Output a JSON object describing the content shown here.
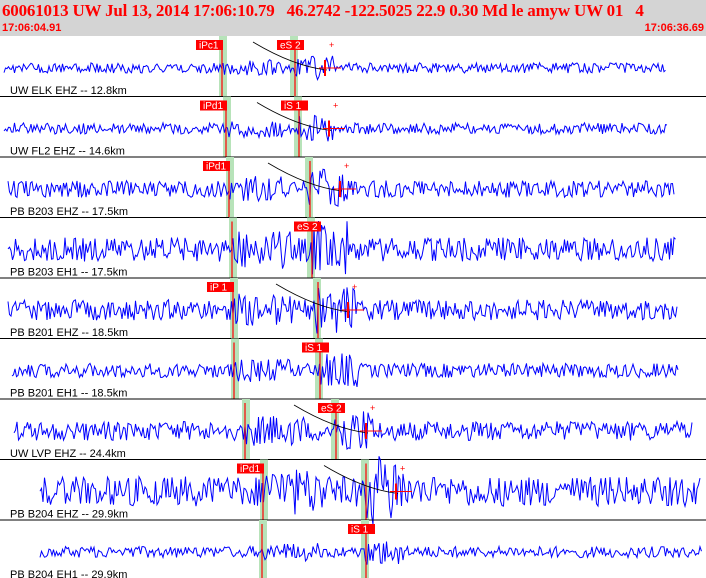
{
  "header": {
    "title": "60061013 UW Jul 13, 2014 17:06:10.79   46.2742 -122.5025 22.9 0.30 Md le amyw UW 01   4",
    "start_time": "17:06:04.91",
    "end_time": "17:06:36.69",
    "background_color": "#d4d4d4",
    "text_color": "#ff0000"
  },
  "colors": {
    "trace": "#0000ff",
    "pick": "#ff0000",
    "pick_band": "#b7e3b9",
    "divider": "#000000"
  },
  "traces": [
    {
      "label": "UW ELK EHZ -- 12.8km",
      "amp": 0.18,
      "p_pick": "iPc1",
      "s_pick": "eS 2",
      "coda": true
    },
    {
      "label": "UW FL2 EHZ -- 14.6km",
      "amp": 0.22,
      "p_pick": "iPd1",
      "s_pick": "iS 1",
      "coda": true
    },
    {
      "label": "PB B203 EHZ -- 17.5km",
      "amp": 0.45,
      "p_pick": "iPd1",
      "s_pick": "",
      "coda": true
    },
    {
      "label": "PB B203 EH1 -- 17.5km",
      "amp": 0.75,
      "p_pick": "",
      "s_pick": "eS 2",
      "coda": false
    },
    {
      "label": "PB B201 EHZ -- 18.5km",
      "amp": 0.6,
      "p_pick": "iP 1",
      "s_pick": "",
      "coda": true
    },
    {
      "label": "PB B201 EH1 -- 18.5km",
      "amp": 0.35,
      "p_pick": "",
      "s_pick": "iS 1",
      "coda": false
    },
    {
      "label": "UW LVP EHZ -- 24.4km",
      "amp": 0.55,
      "p_pick": "",
      "s_pick": "eS 2",
      "coda": true
    },
    {
      "label": "PB B204 EHZ -- 29.9km",
      "amp": 1.0,
      "p_pick": "iPd1",
      "s_pick": "",
      "coda": true
    },
    {
      "label": "PB B204 EH1 -- 29.9km",
      "amp": 0.22,
      "p_pick": "",
      "s_pick": "iS 1",
      "coda": false
    }
  ]
}
